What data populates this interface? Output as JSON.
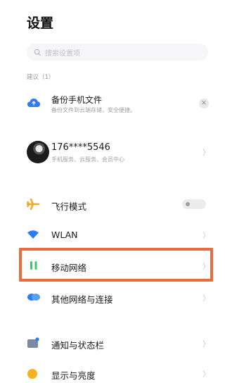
{
  "header": {
    "title": "设置"
  },
  "search": {
    "placeholder": "搜索设置项"
  },
  "suggestions": {
    "label": "建议（1）",
    "item": {
      "title": "备份手机文件",
      "subtitle": "备份文件到云端存储，安全便捷。"
    }
  },
  "account": {
    "phone": "176****5546",
    "subtitle": "手机服务、云服务、会员中心"
  },
  "settings": [
    {
      "key": "airplane",
      "label": "飞行模式",
      "icon": "airplane-icon",
      "toggle": false
    },
    {
      "key": "wlan",
      "label": "WLAN",
      "icon": "wifi-icon"
    },
    {
      "key": "mobile",
      "label": "移动网络",
      "icon": "mobile-network-icon"
    },
    {
      "key": "other",
      "label": "其他网络与连接",
      "icon": "cloud-link-icon"
    },
    {
      "key": "notify",
      "label": "通知与状态栏",
      "icon": "notification-icon"
    },
    {
      "key": "display",
      "label": "显示与亮度",
      "icon": "brightness-icon"
    }
  ],
  "colors": {
    "highlight": "#ec6b3a",
    "accent_blue": "#2f7bf5",
    "airplane_orange": "#f5a623",
    "mobile_green": "#3bc96a"
  }
}
